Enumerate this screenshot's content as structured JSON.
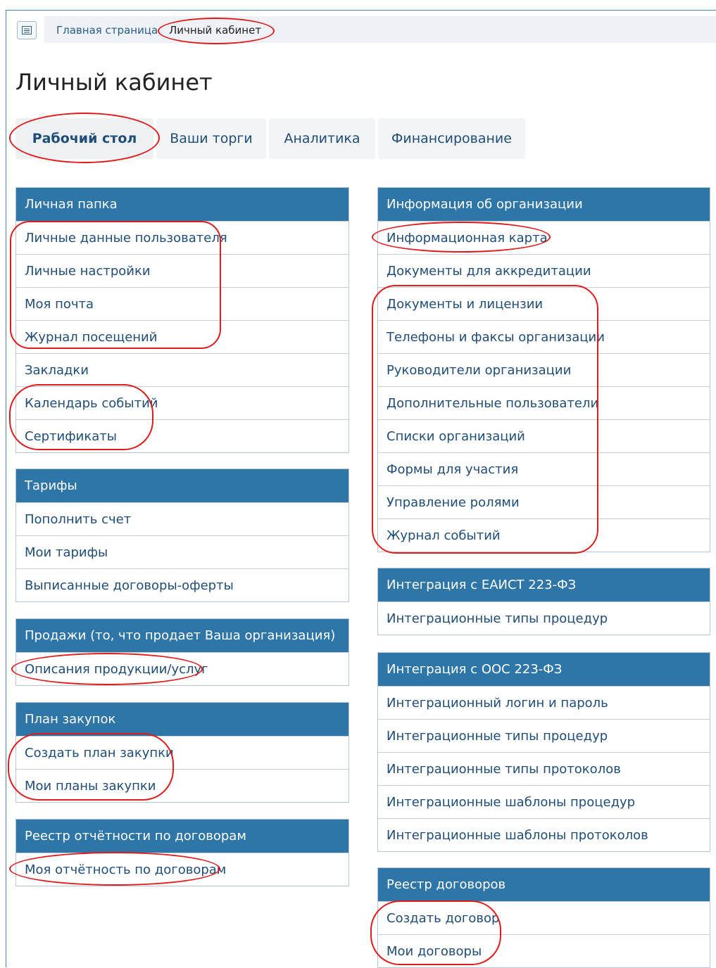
{
  "breadcrumb": {
    "home": "Главная страница",
    "current": "Личный кабинет"
  },
  "page_title": "Личный кабинет",
  "tabs": [
    {
      "label": "Рабочий стол"
    },
    {
      "label": "Ваши торги"
    },
    {
      "label": "Аналитика"
    },
    {
      "label": "Финансирование"
    }
  ],
  "panels": {
    "personal": {
      "title": "Личная папка",
      "items": [
        "Личные данные пользователя",
        "Личные настройки",
        "Моя почта",
        "Журнал посещений",
        "Закладки",
        "Календарь событий",
        "Сертификаты"
      ]
    },
    "tariffs": {
      "title": "Тарифы",
      "items": [
        "Пополнить счет",
        "Мои тарифы",
        "Выписанные договоры-оферты"
      ]
    },
    "sales": {
      "title": "Продажи (то, что продает Ваша организация)",
      "items": [
        "Описания продукции/услуг"
      ]
    },
    "plan": {
      "title": "План закупок",
      "items": [
        "Создать план закупки",
        "Мои планы закупки"
      ]
    },
    "reports": {
      "title": "Реестр отчётности по договорам",
      "items": [
        "Моя отчётность по договорам"
      ]
    },
    "org": {
      "title": "Информация об организации",
      "items": [
        "Информационная карта",
        "Документы для аккредитации",
        "Документы и лицензии",
        "Телефоны и факсы организации",
        "Руководители организации",
        "Дополнительные пользователи",
        "Списки организаций",
        "Формы для участия",
        "Управление ролями",
        "Журнал событий"
      ]
    },
    "eaist": {
      "title": "Интеграция с ЕАИСТ 223-ФЗ",
      "items": [
        "Интеграционные типы процедур"
      ]
    },
    "oos": {
      "title": "Интеграция с ООС 223-ФЗ",
      "items": [
        "Интеграционный логин и пароль",
        "Интеграционные типы процедур",
        "Интеграционные типы протоколов",
        "Интеграционные шаблоны процедур",
        "Интеграционные шаблоны протоколов"
      ]
    },
    "contracts": {
      "title": "Реестр договоров",
      "items": [
        "Создать договор",
        "Мои договоры"
      ]
    }
  }
}
